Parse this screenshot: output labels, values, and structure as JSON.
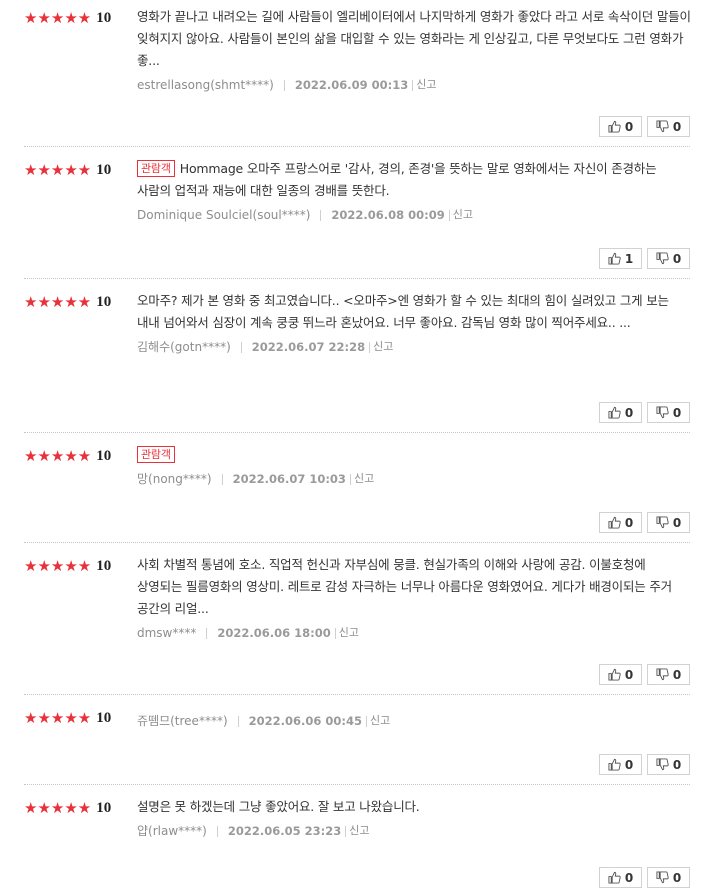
{
  "reviews": [
    {
      "stars": "★★★★★",
      "score": "10",
      "badge": "",
      "text": "영화가 끝나고 내려오는 길에 사람들이 엘리베이터에서 나지막하게 영화가 좋았다 라고 서로 속삭이던 말들이 잊혀지지 않아요. 사람들이 본인의 삶을 대입할 수 있는 영화라는 게 인상깊고, 다른 무엇보다도 그런 영화가 좋...",
      "author": "estrellasong(shmt****)",
      "date": "2022.06.09 00:13",
      "report": "신고",
      "likes": "0",
      "dislikes": "0"
    },
    {
      "stars": "★★★★★",
      "score": "10",
      "badge": "관람객",
      "text": "Hommage 오마주 프랑스어로 '감사, 경의, 존경'을 뜻하는 말로 영화에서는 자신이 존경하는 사람의 업적과 재능에 대한 일종의 경배를 뜻한다.",
      "author": "Dominique Soulciel(soul****)",
      "date": "2022.06.08 00:09",
      "report": "신고",
      "likes": "1",
      "dislikes": "0"
    },
    {
      "stars": "★★★★★",
      "score": "10",
      "badge": "",
      "text": "오마주? 제가 본 영화 중 최고였습니다.. <오마주>엔 영화가 할 수 있는 최대의 힘이 실려있고 그게 보는 내내 넘어와서 심장이 계속 쿵쿵 뛰느라 혼났어요. 너무 좋아요. 감독님 영화 많이 찍어주세요.. ...",
      "author": "김해수(gotn****)",
      "date": "2022.06.07 22:28",
      "report": "신고",
      "likes": "0",
      "dislikes": "0"
    },
    {
      "stars": "★★★★★",
      "score": "10",
      "badge": "관람객",
      "text": "",
      "author": "망(nong****)",
      "date": "2022.06.07 10:03",
      "report": "신고",
      "likes": "0",
      "dislikes": "0"
    },
    {
      "stars": "★★★★★",
      "score": "10",
      "badge": "",
      "text": "사회 차별적 통념에 호소. 직업적 헌신과 자부심에 뭉클. 현실가족의 이해와 사랑에 공감. 이불호청에 상영되는 필름영화의 영상미. 레트로 감성 자극하는 너무나 아름다운 영화였어요. 게다가 배경이되는 주거 공간의 리얼...",
      "author": "dmsw****",
      "date": "2022.06.06 18:00",
      "report": "신고",
      "likes": "0",
      "dislikes": "0"
    },
    {
      "stars": "★★★★★",
      "score": "10",
      "badge": "",
      "text": "",
      "author": "쥬뗌므(tree****)",
      "date": "2022.06.06 00:45",
      "report": "신고",
      "likes": "0",
      "dislikes": "0"
    },
    {
      "stars": "★★★★★",
      "score": "10",
      "badge": "",
      "text": "설명은 못 하겠는데 그냥 좋았어요. 잘 보고 나왔습니다.",
      "author": "얍(rlaw****)",
      "date": "2022.06.05 23:23",
      "report": "신고",
      "likes": "0",
      "dislikes": "0"
    }
  ],
  "icons": {
    "like": "thumbs-up-icon",
    "dislike": "thumbs-down-icon",
    "star": "star-icon"
  },
  "colors": {
    "star": "#e8323b",
    "badge": "#e8323b",
    "meta": "#8d8d8d"
  }
}
